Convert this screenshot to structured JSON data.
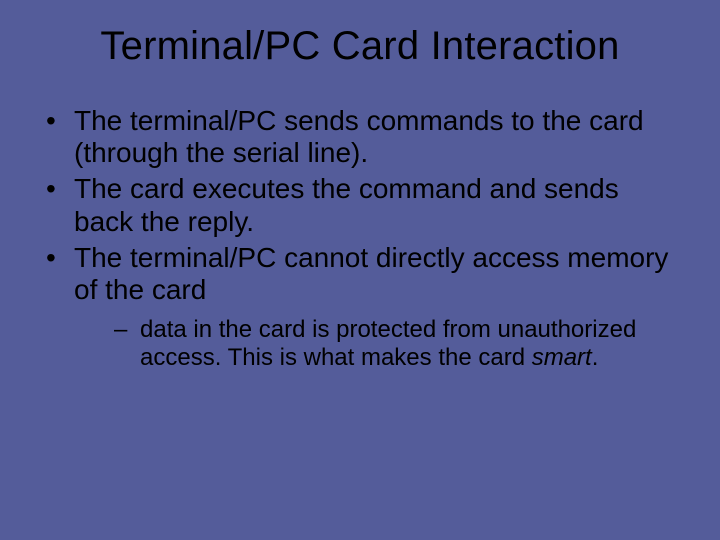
{
  "title": "Terminal/PC Card Interaction",
  "bullets": [
    "The terminal/PC sends commands to the card (through the serial line).",
    "The card executes the command and sends back the reply.",
    "The terminal/PC cannot directly access memory of the card"
  ],
  "sub": {
    "prefix": "data in the card is protected from unauthorized access.  This is what makes the card ",
    "italic": "smart",
    "suffix": "."
  }
}
